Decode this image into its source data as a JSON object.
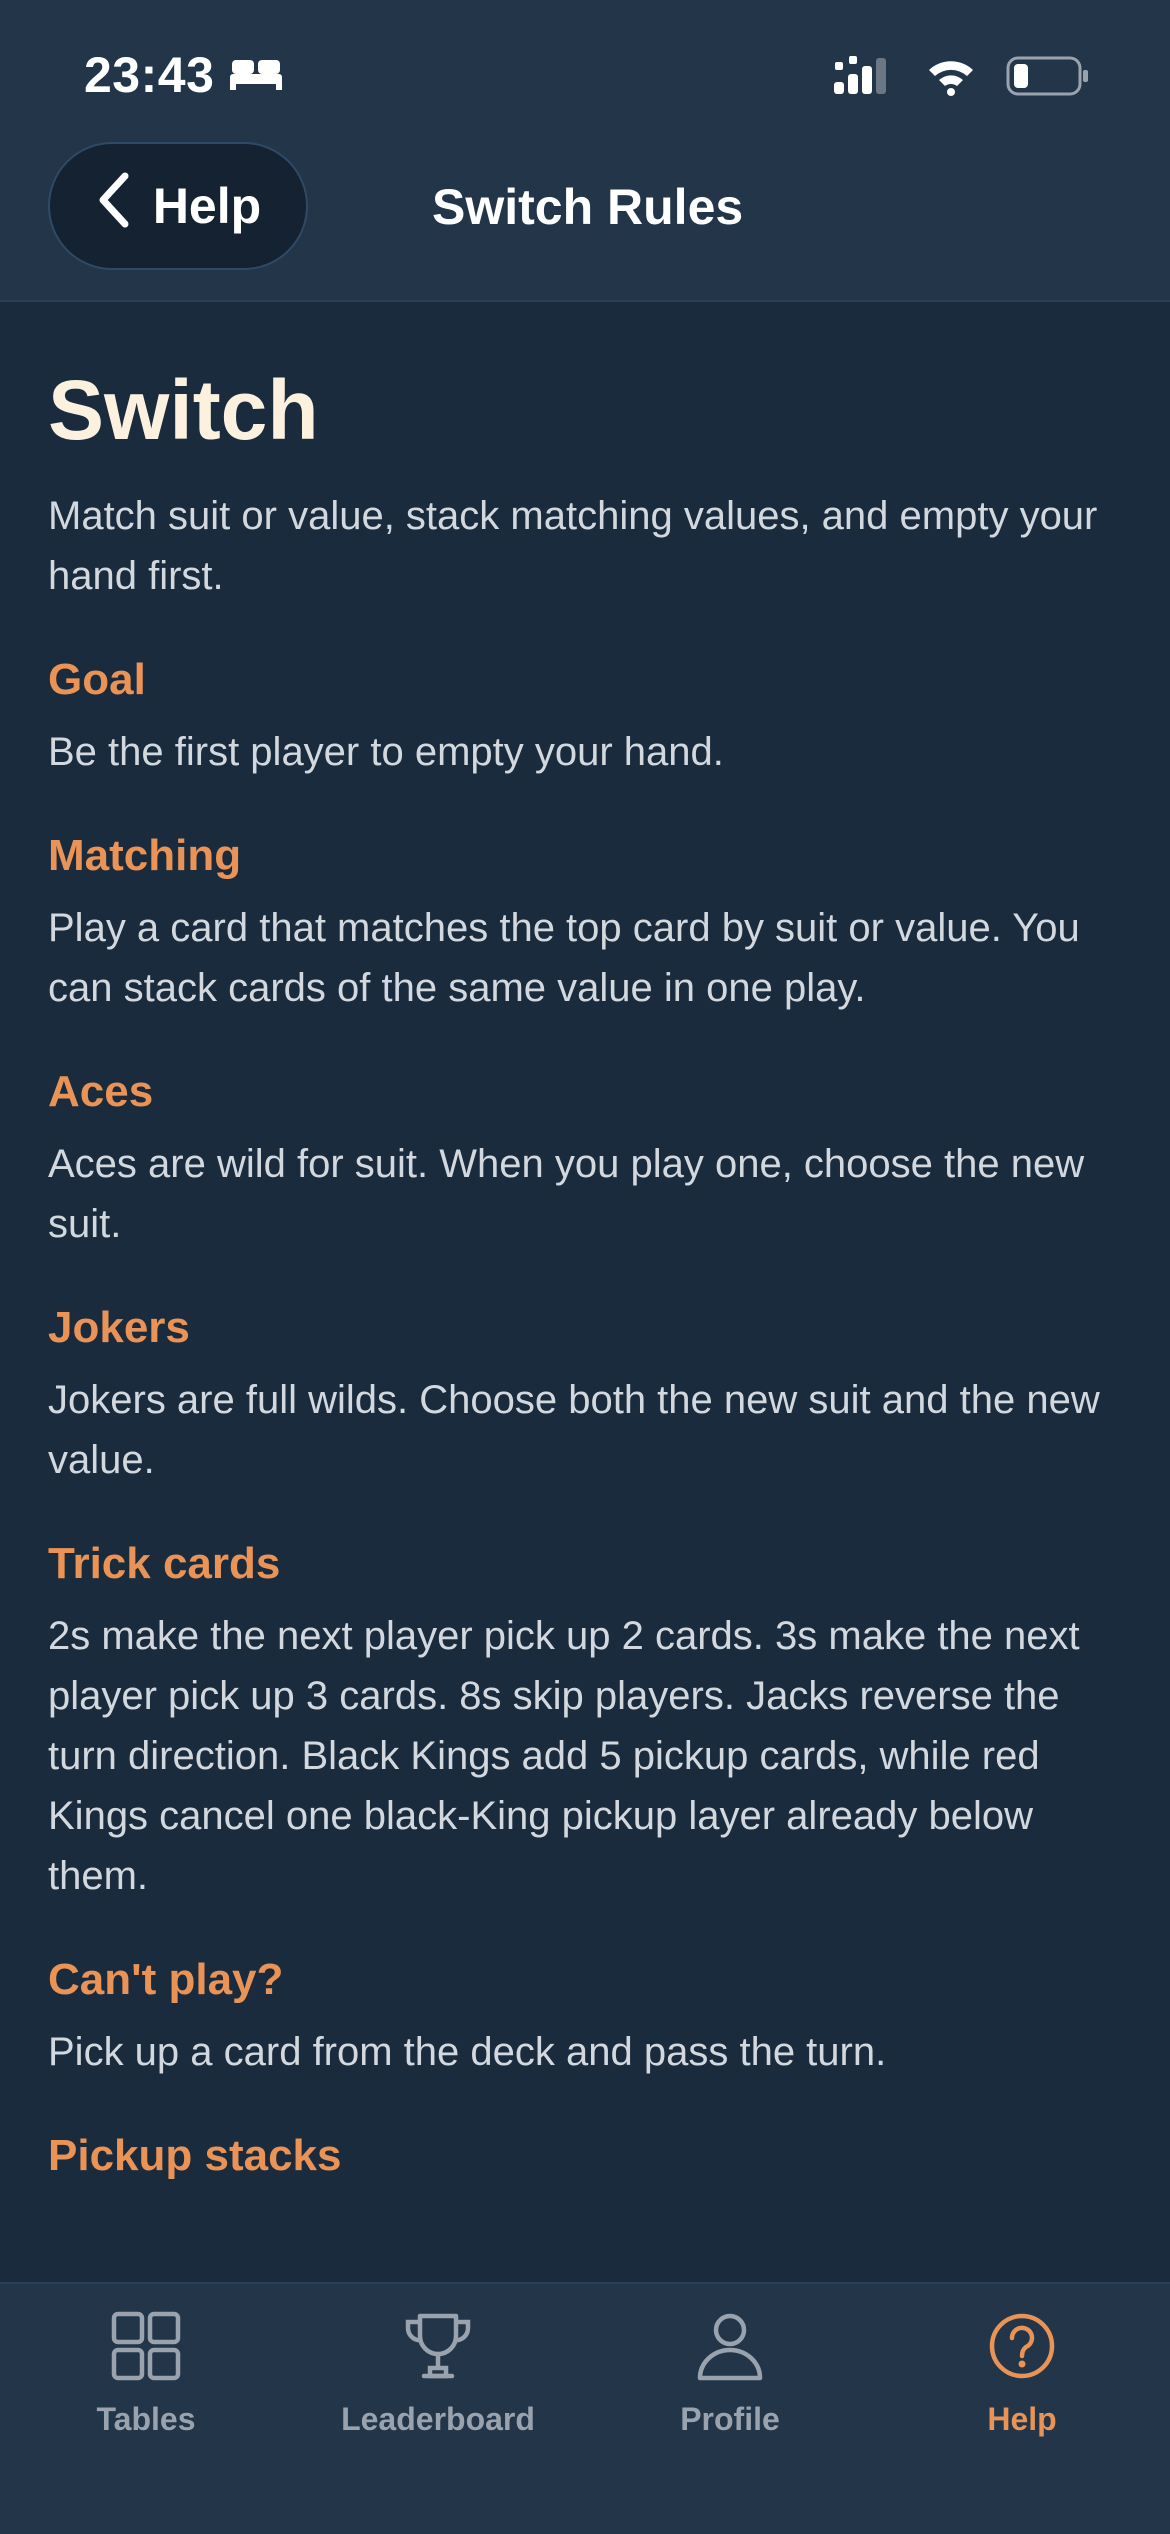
{
  "status_bar": {
    "time": "23:43"
  },
  "nav": {
    "back_label": "Help",
    "title": "Switch Rules"
  },
  "page": {
    "title": "Switch",
    "subtitle": "Match suit or value, stack matching values, and empty your hand first."
  },
  "sections": [
    {
      "heading": "Goal",
      "body": "Be the first player to empty your hand."
    },
    {
      "heading": "Matching",
      "body": "Play a card that matches the top card by suit or value. You can stack cards of the same value in one play."
    },
    {
      "heading": "Aces",
      "body": "Aces are wild for suit. When you play one, choose the new suit."
    },
    {
      "heading": "Jokers",
      "body": "Jokers are full wilds. Choose both the new suit and the new value."
    },
    {
      "heading": "Trick cards",
      "body": "2s make the next player pick up 2 cards. 3s make the next player pick up 3 cards. 8s skip players. Jacks reverse the turn direction. Black Kings add 5 pickup cards, while red Kings cancel one black-King pickup layer already below them."
    },
    {
      "heading": "Can't play?",
      "body": "Pick up a card from the deck and pass the turn."
    },
    {
      "heading": "Pickup stacks",
      "body": ""
    }
  ],
  "tabbar": {
    "tables": "Tables",
    "leaderboard": "Leaderboard",
    "profile": "Profile",
    "help": "Help",
    "active": "help"
  },
  "colors": {
    "accent": "#e99356",
    "background": "#1a2b3e",
    "bar": "#223549"
  },
  "icons": {
    "status": [
      "bed-icon",
      "signal-icon",
      "wifi-icon",
      "battery-icon"
    ],
    "nav": "chevron-left-icon",
    "tabs": [
      "grid-icon",
      "trophy-icon",
      "person-icon",
      "question-circle-icon"
    ]
  }
}
